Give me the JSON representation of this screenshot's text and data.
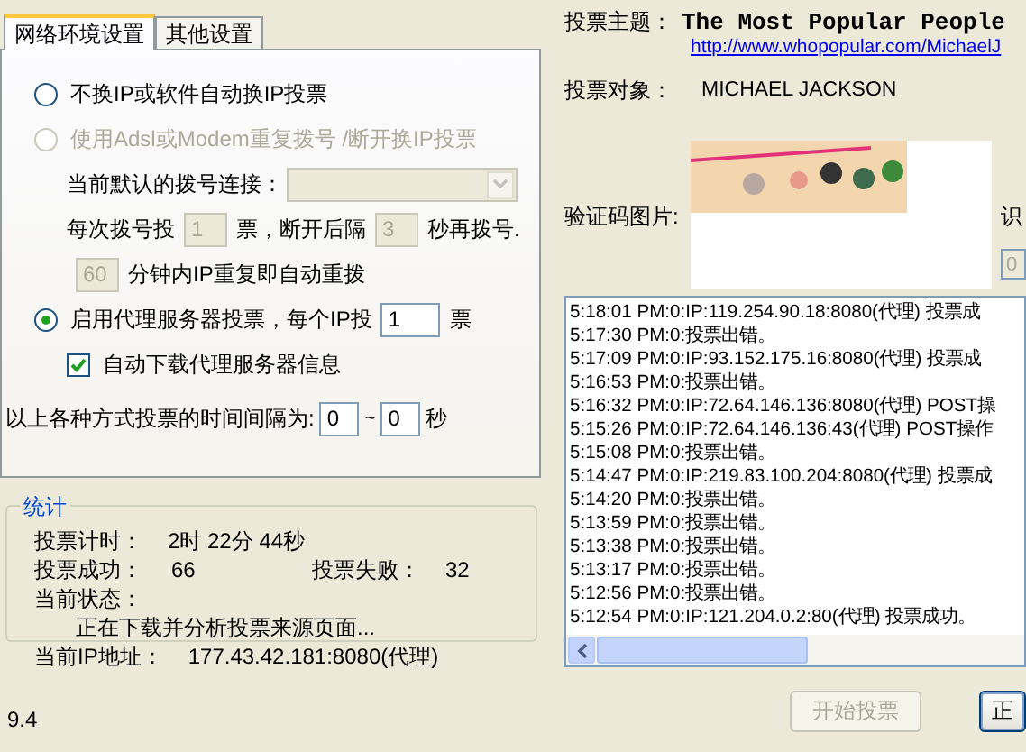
{
  "tabs": [
    {
      "label": "网络环境设置",
      "selected": true
    },
    {
      "label": "其他设置",
      "selected": false
    }
  ],
  "radio_options": [
    {
      "label": "不换IP或软件自动换IP投票",
      "selected": false,
      "disabled": false
    },
    {
      "label": "使用Adsl或Modem重复拨号 /断开换IP投票",
      "selected": false,
      "disabled": true
    },
    {
      "label": "启用代理服务器投票，每个IP投",
      "selected": true,
      "disabled": false,
      "votes_value": "1",
      "votes_unit": "票"
    }
  ],
  "dialup": {
    "connection_label": "当前默认的拨号连接：",
    "votes_label": "每次拨号投",
    "votes_value": "1",
    "pause_label": "票，断开后隔",
    "pause_value": "3",
    "pause_unit": "秒再拨号.",
    "repeat_value": "60",
    "repeat_label": "分钟内IP重复即自动重拨",
    "disabled": true
  },
  "auto_download": {
    "label": "自动下载代理服务器信息",
    "checked": true
  },
  "interval": {
    "label": "以上各种方式投票的时间间隔为:",
    "from": "0",
    "separator": "~",
    "to": "0",
    "unit": "秒"
  },
  "stats": {
    "title": "统计",
    "timer_label": "投票计时：",
    "timer": "2时 22分 44秒",
    "success_label": "投票成功：",
    "success": "66",
    "fail_label": "投票失败：",
    "fail": "32",
    "status_label": "当前状态：",
    "status": "正在下载并分析投票来源页面...",
    "ip_label": "当前IP地址：",
    "ip": "177.43.42.181:8080(代理)"
  },
  "version": "9.4",
  "topic_label": "投票主题：",
  "topic": "The Most Popular People",
  "topic_url": "http://www.whopopular.com/MichaelJ",
  "target_label": "投票对象：",
  "target": "MICHAEL JACKSON",
  "captcha_label": "验证码图片:",
  "recognize_label": "识",
  "recognize_value": "0",
  "log": [
    "5:18:01 PM:0:IP:119.254.90.18:8080(代理) 投票成",
    "5:17:30 PM:0:投票出错。",
    "5:17:09 PM:0:IP:93.152.175.16:8080(代理) 投票成",
    "5:16:53 PM:0:投票出错。",
    "5:16:32 PM:0:IP:72.64.146.136:8080(代理) POST操",
    "5:15:26 PM:0:IP:72.64.146.136:43(代理) POST操作",
    "5:15:08 PM:0:投票出错。",
    "5:14:47 PM:0:IP:219.83.100.204:8080(代理) 投票成",
    "5:14:20 PM:0:投票出错。",
    "5:13:59 PM:0:投票出错。",
    "5:13:38 PM:0:投票出错。",
    "5:13:17 PM:0:投票出错。",
    "5:12:56 PM:0:投票出错。",
    "5:12:54 PM:0:IP:121.204.0.2:80(代理) 投票成功。"
  ],
  "buttons": [
    {
      "label": "开始投票",
      "disabled": true
    },
    {
      "label": "正",
      "disabled": false
    }
  ]
}
